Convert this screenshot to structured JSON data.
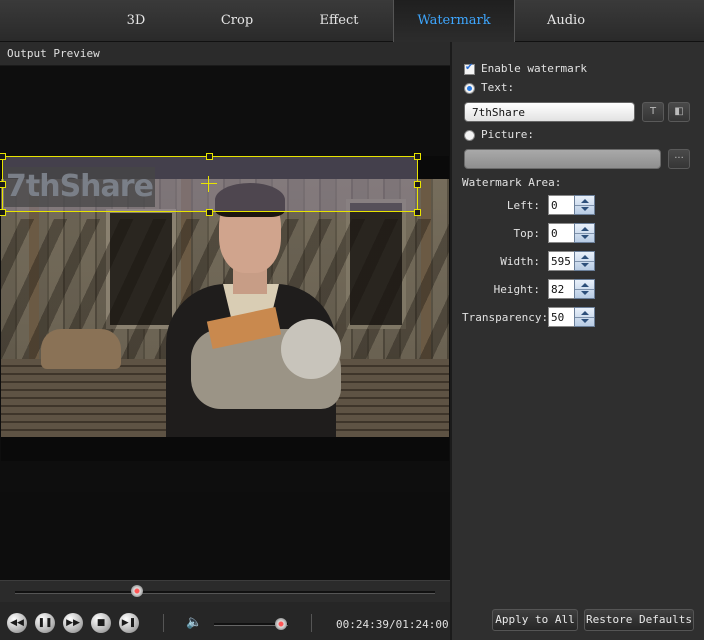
{
  "tabs": [
    {
      "label": "3D"
    },
    {
      "label": "Crop"
    },
    {
      "label": "Effect"
    },
    {
      "label": "Watermark",
      "active": true
    },
    {
      "label": "Audio"
    }
  ],
  "preview": {
    "label": "Output Preview",
    "watermark_text": "7thShare"
  },
  "player": {
    "progress_fraction": 0.29,
    "volume_fraction": 0.91,
    "time": "00:24:39/01:24:00",
    "buttons": [
      "rewind-icon",
      "pause-icon",
      "fast-forward-icon",
      "stop-icon",
      "next-icon",
      "volume-icon"
    ]
  },
  "watermark": {
    "enable_label": "Enable watermark",
    "enable_checked": true,
    "text_label": "Text:",
    "text_selected": true,
    "text_value": "7thShare",
    "picture_label": "Picture:",
    "picture_value": "",
    "browse_label": "···",
    "area_label": "Watermark Area:",
    "fields": [
      {
        "label": "Left:",
        "value": "0"
      },
      {
        "label": "Top:",
        "value": "0"
      },
      {
        "label": "Width:",
        "value": "595"
      },
      {
        "label": "Height:",
        "value": "82"
      },
      {
        "label": "Transparency:",
        "value": "50"
      }
    ]
  },
  "footer": {
    "apply_all": "Apply to All",
    "restore": "Restore Defaults"
  },
  "colors": {
    "accent": "#3ea7ff",
    "selection": "#e8e400"
  }
}
